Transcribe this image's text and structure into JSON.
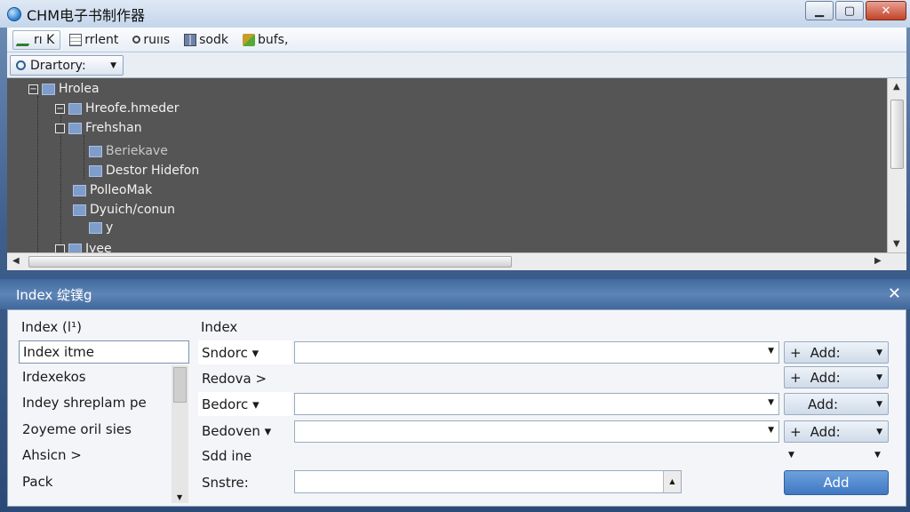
{
  "window": {
    "title": "CHM电子书制作器",
    "minimize": "▁",
    "maximize": "▢",
    "close": "✕"
  },
  "toolbar": {
    "items": [
      {
        "label": "rı K",
        "icon": "pencil-icon"
      },
      {
        "label": "rrlent",
        "icon": "document-icon"
      },
      {
        "label": "ruııs",
        "icon": "key-icon"
      },
      {
        "label": "sodk",
        "icon": "grid-icon"
      },
      {
        "label": "bufs,",
        "icon": "brush-icon"
      }
    ]
  },
  "directory": {
    "label": "Drartory:",
    "caret": "▼"
  },
  "tree": {
    "nodes": [
      {
        "label": "Hrolea",
        "expander": "−"
      },
      {
        "label": "Hreofe.hmeder",
        "expander": "−"
      },
      {
        "label": "Frehshan",
        "expander": ""
      },
      {
        "label": "Beriekave",
        "expander": ""
      },
      {
        "label": "Destor Hidefon",
        "expander": ""
      },
      {
        "label": "PolleoMak",
        "expander": ""
      },
      {
        "label": "Dyuich/conun",
        "expander": ""
      },
      {
        "label": "y",
        "expander": ""
      },
      {
        "label": "Jyee",
        "expander": ""
      }
    ],
    "scroll_up": "▲",
    "scroll_down": "▼",
    "scroll_left": "◀",
    "scroll_right": "▶"
  },
  "index_dialog": {
    "title": "Index 绽镤g",
    "close": "✕",
    "left_label": "Index (l¹)",
    "index_input_value": "Index itme",
    "list_items": [
      "Irdexekos",
      "Indey shreplam pe",
      "2oyeme oril sies",
      "Ahsicn >",
      "Pack"
    ],
    "right_heading": "Index",
    "rows": [
      {
        "label": "Sndorc ▾",
        "add_label": "Add:",
        "plus": "+"
      },
      {
        "label": "Redova >",
        "add_label": "Add:",
        "plus": "+"
      },
      {
        "label": "Bedorc ▾",
        "add_label": "Add:",
        "plus": ""
      },
      {
        "label": "Bedoven ▾",
        "add_label": "Add:",
        "plus": "+"
      }
    ],
    "sdd_label": "Sdd ine",
    "snstre_label": "Snstre:",
    "add_button": "Add"
  }
}
